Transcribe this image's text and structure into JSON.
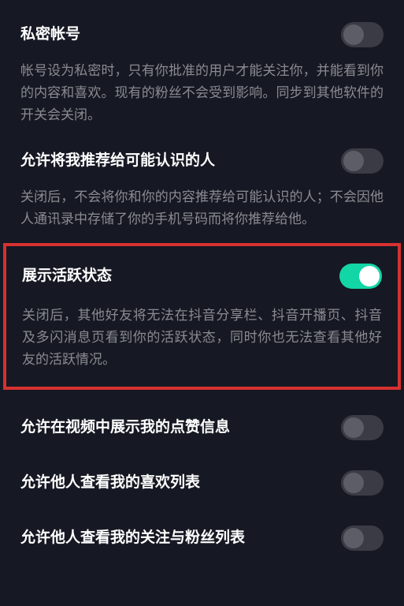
{
  "settings": {
    "private_account": {
      "title": "私密帐号",
      "desc": "帐号设为私密时，只有你批准的用户才能关注你，并能看到你的内容和喜欢。现有的粉丝不会受到影响。同步到其他软件的开关会关闭。",
      "enabled": false
    },
    "recommend_to_contacts": {
      "title": "允许将我推荐给可能认识的人",
      "desc": "关闭后，不会将你和你的内容推荐给可能认识的人；不会因他人通讯录中存储了你的手机号码而将你推荐给他。",
      "enabled": false
    },
    "show_active_status": {
      "title": "展示活跃状态",
      "desc": "关闭后，其他好友将无法在抖音分享栏、抖音开播页、抖音及多闪消息页看到你的活跃状态，同时你也无法查看其他好友的活跃情况。",
      "enabled": true
    },
    "show_likes_in_video": {
      "title": "允许在视频中展示我的点赞信息",
      "enabled": false
    },
    "allow_view_likes_list": {
      "title": "允许他人查看我的喜欢列表",
      "enabled": false
    },
    "allow_view_follow_list": {
      "title": "允许他人查看我的关注与粉丝列表",
      "enabled": false
    }
  },
  "colors": {
    "background": "#161823",
    "text_primary": "#ffffff",
    "text_secondary": "#8a8b91",
    "toggle_on": "#12d6a5",
    "toggle_off": "#3a3b44",
    "highlight_border": "#d63131"
  }
}
